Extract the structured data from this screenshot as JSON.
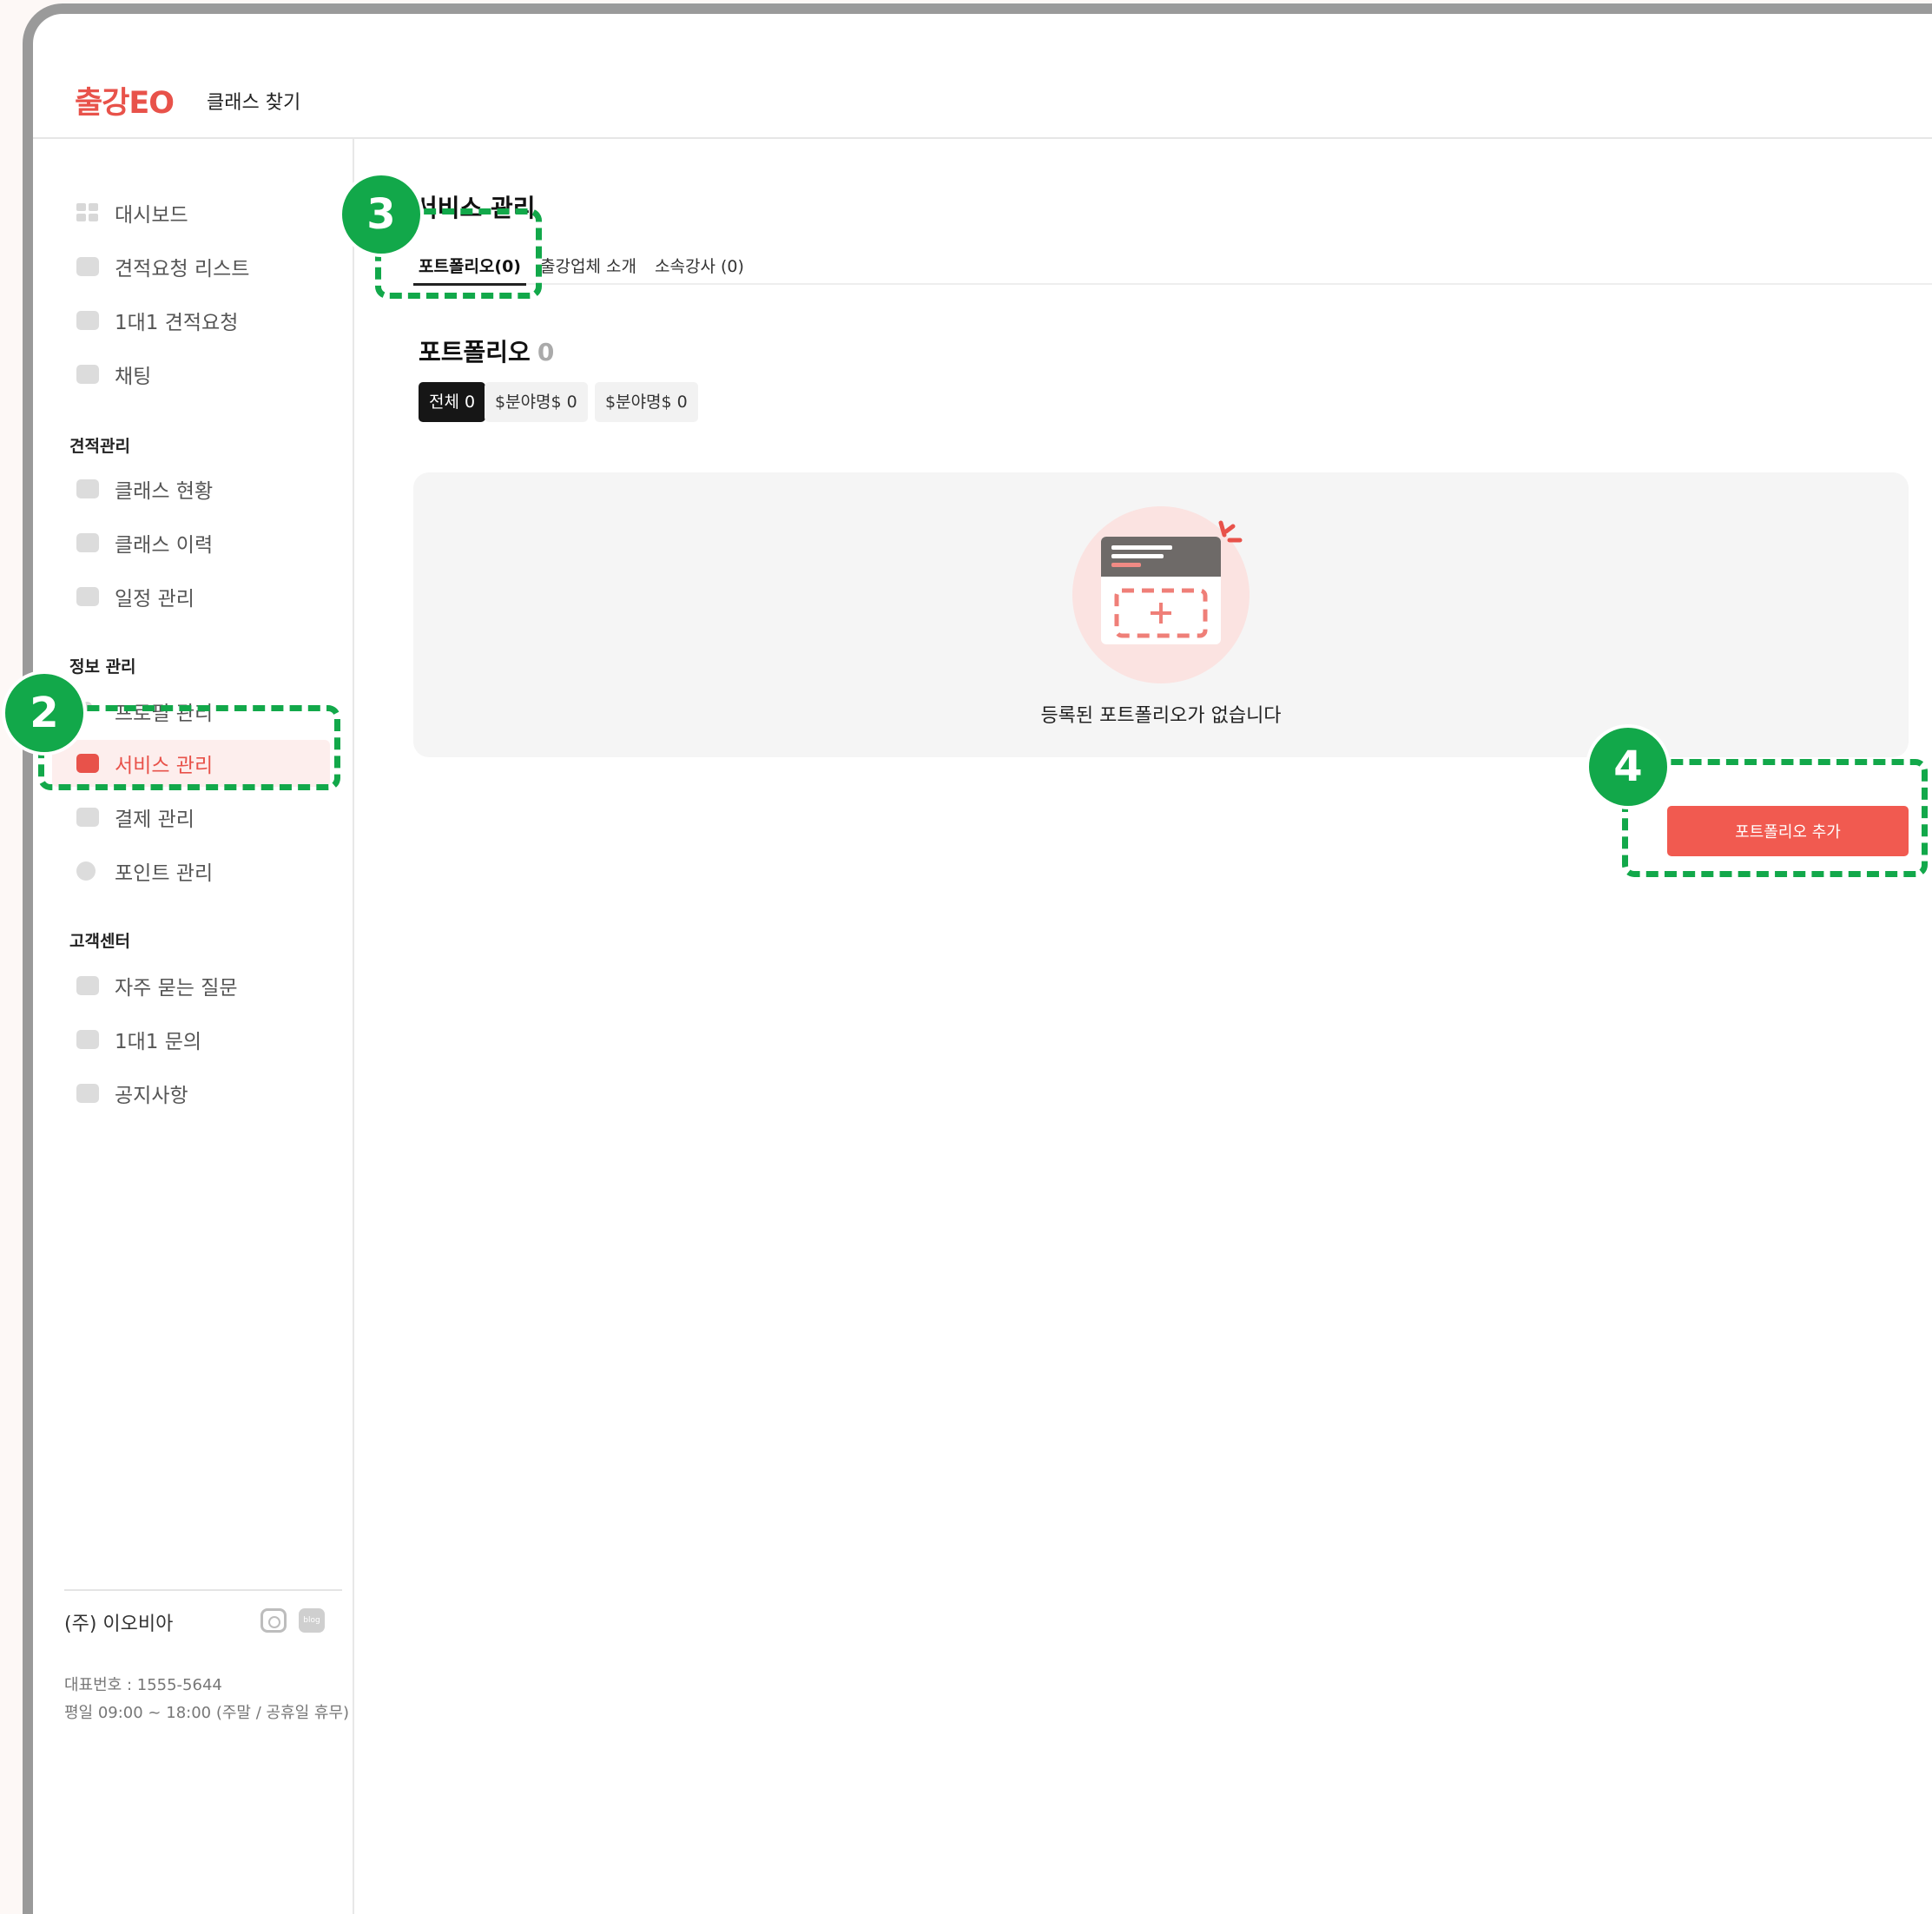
{
  "header": {
    "logo": "출강EO",
    "nav_find_class": "클래스 찾기"
  },
  "sidebar": {
    "items_top": [
      "대시보드",
      "견적요청 리스트",
      "1대1 견적요청",
      "채팅"
    ],
    "group_estimate": "견적관리",
    "items_estimate": [
      "클래스 현황",
      "클래스 이력",
      "일정 관리"
    ],
    "group_info": "정보 관리",
    "items_info": [
      "프로필 관리",
      "서비스 관리",
      "결제 관리",
      "포인트 관리"
    ],
    "group_support": "고객센터",
    "items_support": [
      "자주 묻는 질문",
      "1대1 문의",
      "공지사항"
    ],
    "company": "(주) 이오비아",
    "social_blog": "blog",
    "phone": "대표번호 : 1555-5644",
    "hours": "평일 09:00 ~ 18:00 (주말 / 공휴일 휴무)"
  },
  "main": {
    "title": "서비스 관리",
    "tabs": [
      "포트폴리오(0)",
      "출강업체 소개",
      "소속강사 (0)"
    ],
    "section_title": "포트폴리오",
    "section_count": "0",
    "chips": [
      "전체 0",
      "$분야명$ 0",
      "$분야명$ 0"
    ],
    "empty_message": "등록된 포트폴리오가 없습니다",
    "add_button": "포트폴리오 추가"
  },
  "annotations": [
    "2",
    "3",
    "4"
  ],
  "colors": {
    "brand": "#e8524a",
    "button": "#f15a50",
    "annotation": "#12a84a"
  }
}
